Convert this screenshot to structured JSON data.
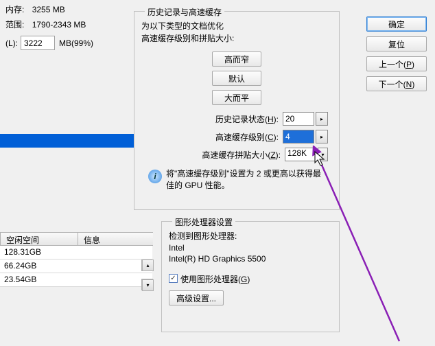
{
  "left": {
    "mem_label": "内存:",
    "mem_value": "3255 MB",
    "range_label": "范围:",
    "range_value": "1790-2343 MB",
    "input_label": "(L):",
    "input_value": "3222",
    "input_unit": "MB(99%)",
    "plus": "+"
  },
  "cache": {
    "legend": "历史记录与高速缓存",
    "line1": "为以下类型的文档优化",
    "line2": "高速缓存级别和拼贴大小:",
    "btns": {
      "tall": "高而窄",
      "default": "默认",
      "big": "大而平"
    },
    "history_label_pre": "历史记录状态(",
    "history_label_key": "H",
    "history_label_post": "):",
    "history_value": "20",
    "level_label_pre": "高速缓存级别(",
    "level_label_key": "C",
    "level_label_post": "):",
    "level_value": "4",
    "tile_label_pre": "高速缓存拼贴大小(",
    "tile_label_key": "Z",
    "tile_label_post": "):",
    "tile_value": "128K",
    "info": "将\"高速缓存级别\"设置为 2 或更高以获得最佳的 GPU 性能。"
  },
  "gpu": {
    "legend": "图形处理器设置",
    "detect": "检测到图形处理器:",
    "vendor": "Intel",
    "model": "Intel(R) HD Graphics 5500",
    "chk_label_pre": "使用图形处理器(",
    "chk_label_key": "G",
    "chk_label_post": ")",
    "advanced": "高级设置..."
  },
  "table": {
    "hdr1": "空闲空间",
    "hdr2": "信息",
    "rows": [
      "128.31GB",
      "66.24GB",
      "23.54GB"
    ]
  },
  "right": {
    "ok": "确定",
    "reset": "复位",
    "prev_pre": "上一个(",
    "prev_key": "P",
    "prev_post": ")",
    "next_pre": "下一个(",
    "next_key": "N",
    "next_post": ")"
  },
  "arrows": {
    "right": "▸",
    "down": "▾",
    "up": "▴",
    "check": "✓"
  }
}
